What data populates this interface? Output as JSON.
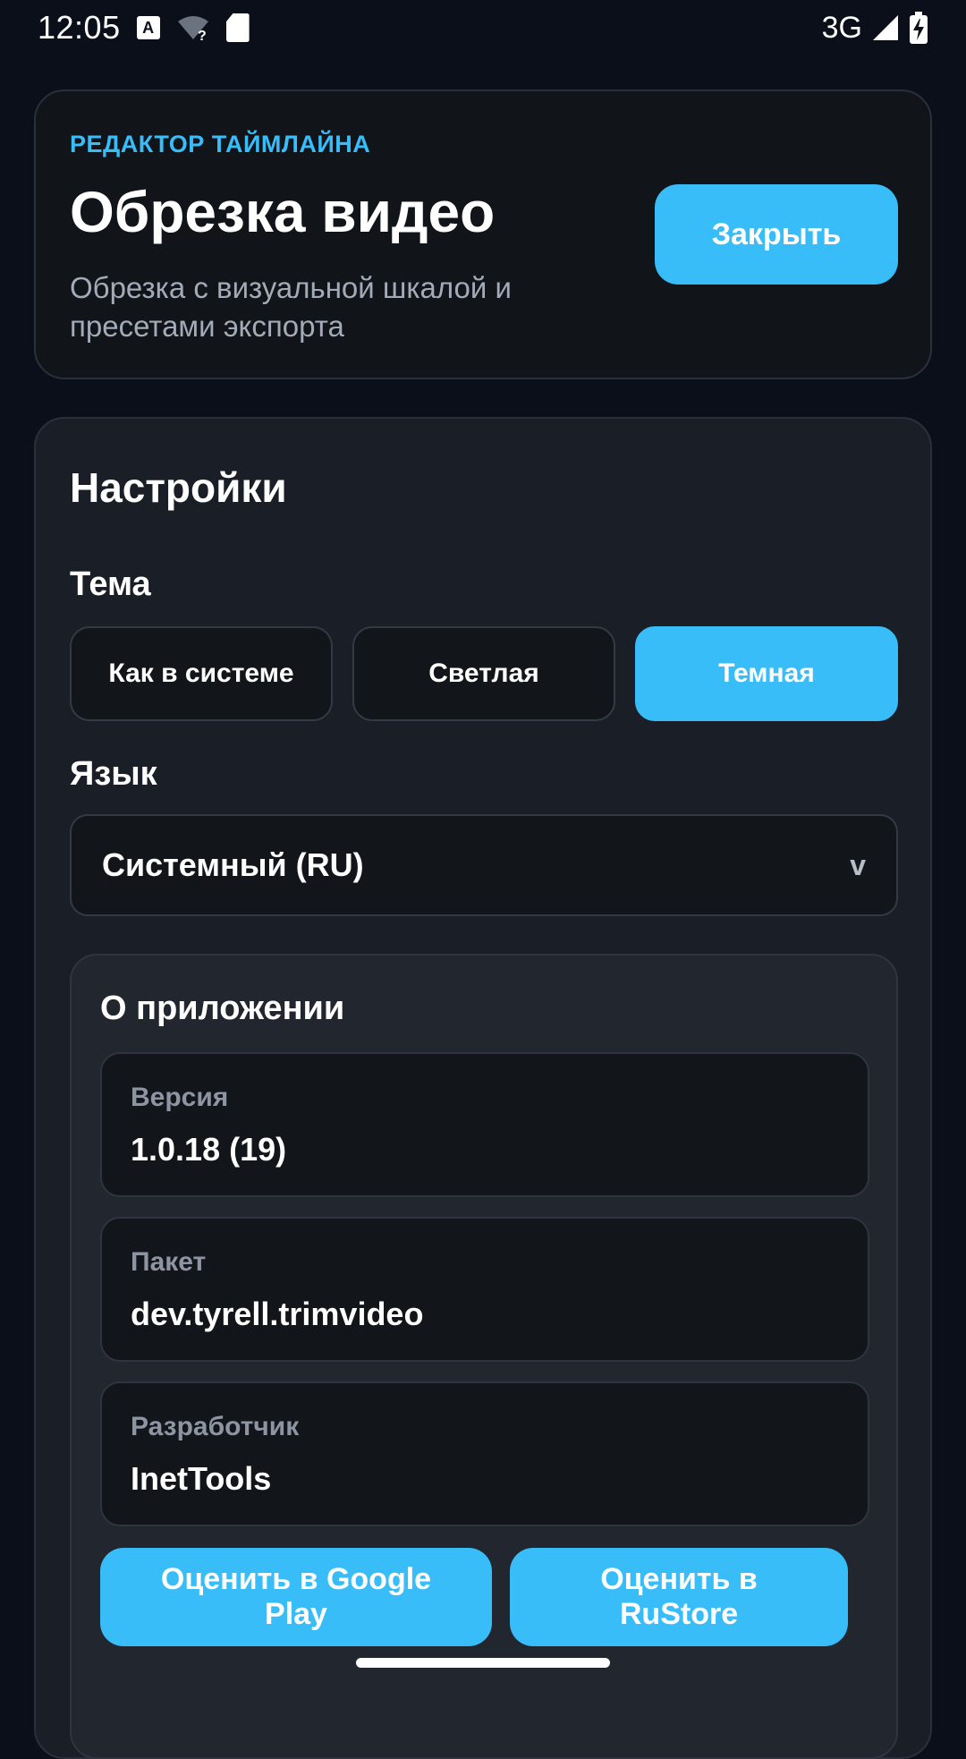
{
  "status_bar": {
    "time": "12:05",
    "network": "3G",
    "icons": [
      "a-badge-icon",
      "wifi-unknown-icon",
      "sd-card-icon",
      "signal-icon",
      "battery-charging-icon"
    ]
  },
  "header": {
    "eyebrow": "РЕДАКТОР ТАЙМЛАЙНА",
    "title": "Обрезка видео",
    "subtitle": "Обрезка с визуальной шкалой и пресетами экспорта",
    "close_label": "Закрыть"
  },
  "settings": {
    "title": "Настройки",
    "theme": {
      "label": "Тема",
      "options": [
        "Как в системе",
        "Светлая",
        "Темная"
      ],
      "selected": "Темная"
    },
    "language": {
      "label": "Язык",
      "value": "Системный (RU)",
      "chevron": "v"
    },
    "about": {
      "title": "О приложении",
      "items": [
        {
          "label": "Версия",
          "value": "1.0.18 (19)"
        },
        {
          "label": "Пакет",
          "value": "dev.tyrell.trimvideo"
        },
        {
          "label": "Разработчик",
          "value": "InetTools"
        }
      ],
      "rate_google": "Оценить в Google Play",
      "rate_rustore": "Оценить в RuStore"
    }
  },
  "colors": {
    "accent": "#38bdf8",
    "background": "#0a0f1a",
    "card": "#1a1e26",
    "muted_text": "#a3abb8"
  }
}
